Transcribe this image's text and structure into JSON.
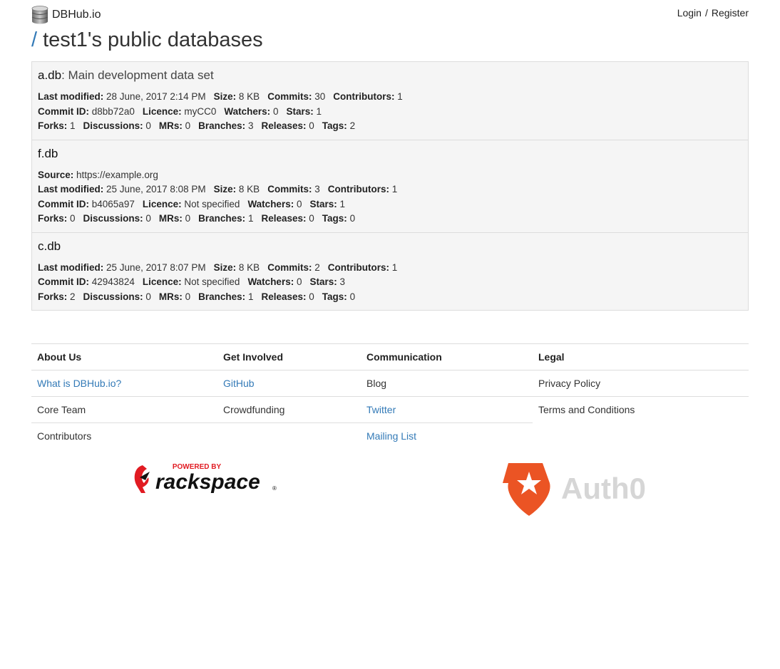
{
  "brand": {
    "name": "DBHub.io",
    "icon": "database-icon"
  },
  "auth": {
    "login": "Login",
    "separator": "/",
    "register": "Register"
  },
  "page": {
    "slash": "/",
    "title": "test1's public databases"
  },
  "databases": [
    {
      "name": "a.db",
      "description": ": Main development data set",
      "lines": [
        [
          [
            "Last modified:",
            "28 June, 2017 2:14 PM"
          ],
          [
            "Size:",
            "8 KB"
          ],
          [
            "Commits:",
            "30"
          ],
          [
            "Contributors:",
            "1"
          ]
        ],
        [
          [
            "Commit ID:",
            "d8bb72a0"
          ],
          [
            "Licence:",
            "myCC0"
          ],
          [
            "Watchers:",
            "0"
          ],
          [
            "Stars:",
            "1"
          ]
        ],
        [
          [
            "Forks:",
            "1"
          ],
          [
            "Discussions:",
            "0"
          ],
          [
            "MRs:",
            "0"
          ],
          [
            "Branches:",
            "3"
          ],
          [
            "Releases:",
            "0"
          ],
          [
            "Tags:",
            "2"
          ]
        ]
      ]
    },
    {
      "name": "f.db",
      "description": "",
      "lines": [
        [
          [
            "Source:",
            "https://example.org"
          ]
        ],
        [
          [
            "Last modified:",
            "25 June, 2017 8:08 PM"
          ],
          [
            "Size:",
            "8 KB"
          ],
          [
            "Commits:",
            "3"
          ],
          [
            "Contributors:",
            "1"
          ]
        ],
        [
          [
            "Commit ID:",
            "b4065a97"
          ],
          [
            "Licence:",
            "Not specified"
          ],
          [
            "Watchers:",
            "0"
          ],
          [
            "Stars:",
            "1"
          ]
        ],
        [
          [
            "Forks:",
            "0"
          ],
          [
            "Discussions:",
            "0"
          ],
          [
            "MRs:",
            "0"
          ],
          [
            "Branches:",
            "1"
          ],
          [
            "Releases:",
            "0"
          ],
          [
            "Tags:",
            "0"
          ]
        ]
      ]
    },
    {
      "name": "c.db",
      "description": "",
      "lines": [
        [
          [
            "Last modified:",
            "25 June, 2017 8:07 PM"
          ],
          [
            "Size:",
            "8 KB"
          ],
          [
            "Commits:",
            "2"
          ],
          [
            "Contributors:",
            "1"
          ]
        ],
        [
          [
            "Commit ID:",
            "42943824"
          ],
          [
            "Licence:",
            "Not specified"
          ],
          [
            "Watchers:",
            "0"
          ],
          [
            "Stars:",
            "3"
          ]
        ],
        [
          [
            "Forks:",
            "2"
          ],
          [
            "Discussions:",
            "0"
          ],
          [
            "MRs:",
            "0"
          ],
          [
            "Branches:",
            "1"
          ],
          [
            "Releases:",
            "0"
          ],
          [
            "Tags:",
            "0"
          ]
        ]
      ]
    }
  ],
  "footer": {
    "headers": [
      "About Us",
      "Get Involved",
      "Communication",
      "Legal"
    ],
    "rows": [
      [
        {
          "text": "What is DBHub.io?",
          "link": true
        },
        {
          "text": "GitHub",
          "link": true
        },
        {
          "text": "Blog",
          "link": false
        },
        {
          "text": "Privacy Policy",
          "link": false
        }
      ],
      [
        {
          "text": "Core Team",
          "link": false
        },
        {
          "text": "Crowdfunding",
          "link": false
        },
        {
          "text": "Twitter",
          "link": true
        },
        {
          "text": "Terms and Conditions",
          "link": false
        }
      ],
      [
        {
          "text": "Contributors",
          "link": false
        },
        {
          "text": "",
          "link": false
        },
        {
          "text": "Mailing List",
          "link": true
        },
        null
      ]
    ]
  },
  "sponsors": {
    "rackspace": {
      "tagline": "POWERED BY",
      "name": "rackspace",
      "mark": "®"
    },
    "auth0": {
      "name": "Auth0"
    }
  },
  "colors": {
    "link": "#337ab7",
    "rackspace_red": "#e11b22",
    "auth0_orange": "#eb5424"
  }
}
